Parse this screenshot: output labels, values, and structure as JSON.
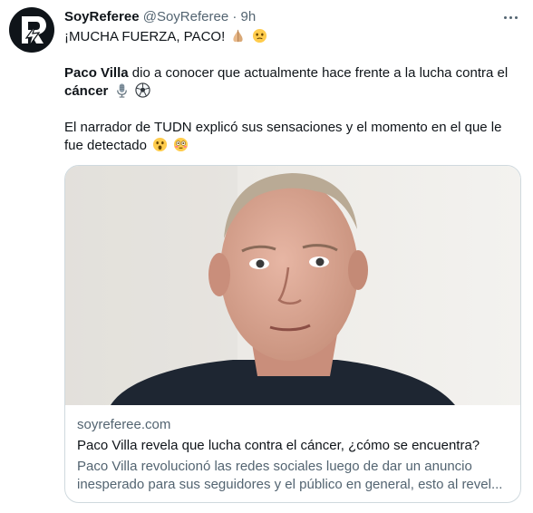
{
  "tweet": {
    "display_name": "SoyReferee",
    "handle": "@SoyReferee",
    "separator": "·",
    "time": "9h",
    "line1": "¡MUCHA FUERZA, PACO!",
    "line2_name": "Paco Villa",
    "line2_text": " dio a conocer que actualmente hace frente a la lucha contra el ",
    "line2_bold": "cáncer",
    "line3": "El narrador de TUDN explicó sus sensaciones y el momento en el que le fue detectado"
  },
  "card": {
    "domain": "soyreferee.com",
    "title": "Paco Villa revela que lucha contra el cáncer, ¿cómo se encuentra?",
    "desc_line1": "Paco Villa revolucionó las redes sociales luego de dar un anuncio",
    "desc_line2": "inesperado para sus seguidores y el público en general, esto al revel..."
  },
  "icons": [
    "logo-icon",
    "more-icon",
    "folded-hands-icon",
    "face-icon",
    "microphone-icon",
    "soccer-ball-icon",
    "astonished-face-icon",
    "flushed-face-icon"
  ],
  "colors": {
    "text": "#0f1419",
    "secondary": "#536471",
    "border": "#cfd9de"
  }
}
